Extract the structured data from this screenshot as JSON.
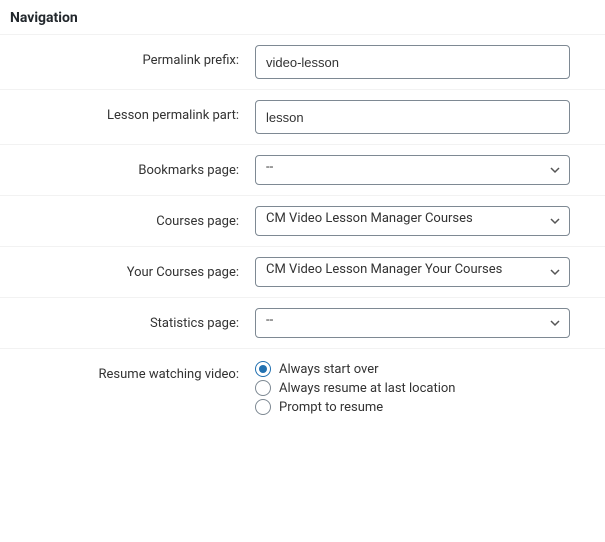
{
  "section": {
    "title": "Navigation"
  },
  "fields": {
    "permalink_prefix": {
      "label": "Permalink prefix:",
      "value": "video-lesson"
    },
    "lesson_permalink_part": {
      "label": "Lesson permalink part:",
      "value": "lesson"
    },
    "bookmarks_page": {
      "label": "Bookmarks page:",
      "value": "--"
    },
    "courses_page": {
      "label": "Courses page:",
      "value": "CM Video Lesson Manager Courses"
    },
    "your_courses_page": {
      "label": "Your Courses page:",
      "value": "CM Video Lesson Manager Your Courses"
    },
    "statistics_page": {
      "label": "Statistics page:",
      "value": "--"
    },
    "resume_watching": {
      "label": "Resume watching video:",
      "options": [
        {
          "label": "Always start over",
          "checked": true
        },
        {
          "label": "Always resume at last location",
          "checked": false
        },
        {
          "label": "Prompt to resume",
          "checked": false
        }
      ]
    }
  }
}
